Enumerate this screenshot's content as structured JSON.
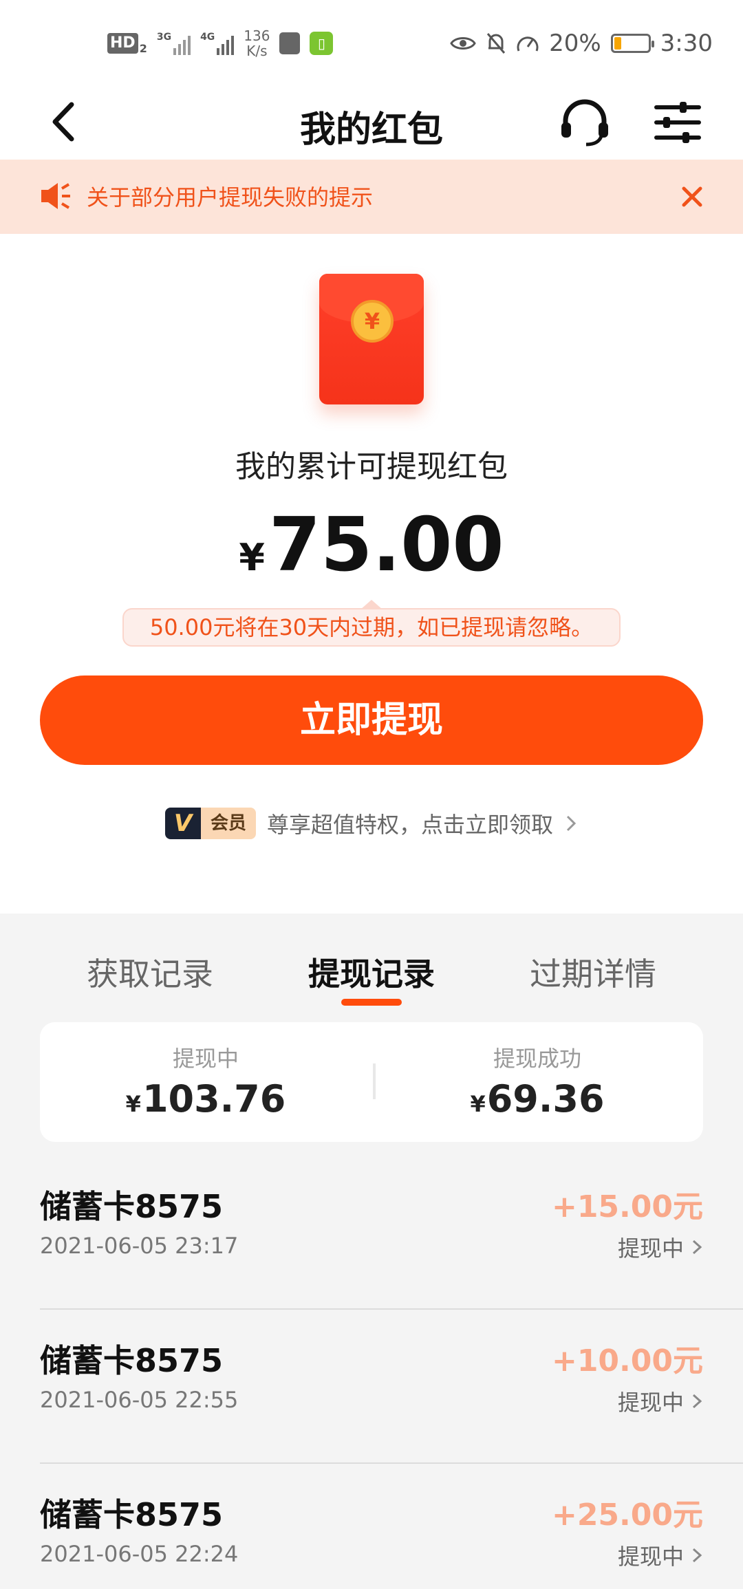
{
  "status_bar": {
    "hd": "HD",
    "hd_sub": "2",
    "net1": "3G",
    "net2": "4G",
    "speed_value": "136",
    "speed_unit": "K/s",
    "battery": "20%",
    "battery_level": 0.2,
    "time": "3:30"
  },
  "header": {
    "title": "我的红包"
  },
  "notice": {
    "text": "关于部分用户提现失败的提示"
  },
  "balance": {
    "label": "我的累计可提现红包",
    "currency": "¥",
    "amount": "75.00",
    "expire_tip": "50.00元将在30天内过期，如已提现请忽略。",
    "withdraw_button": "立即提现"
  },
  "vip": {
    "badge_text": "会员",
    "promo_text": "尊享超值特权，点击立即领取"
  },
  "tabs": [
    {
      "label": "获取记录"
    },
    {
      "label": "提现记录"
    },
    {
      "label": "过期详情"
    }
  ],
  "summary": {
    "pending_label": "提现中",
    "pending_currency": "¥",
    "pending_value": "103.76",
    "success_label": "提现成功",
    "success_currency": "¥",
    "success_value": "69.36"
  },
  "records": [
    {
      "title": "储蓄卡8575",
      "time": "2021-06-05 23:17",
      "amount": "+15.00元",
      "status": "提现中"
    },
    {
      "title": "储蓄卡8575",
      "time": "2021-06-05 22:55",
      "amount": "+10.00元",
      "status": "提现中"
    },
    {
      "title": "储蓄卡8575",
      "time": "2021-06-05 22:24",
      "amount": "+25.00元",
      "status": "提现中"
    }
  ],
  "colors": {
    "accent": "#ff4c0c",
    "notice_bg": "#fde4d9",
    "amount_pending": "#f9a98a"
  }
}
